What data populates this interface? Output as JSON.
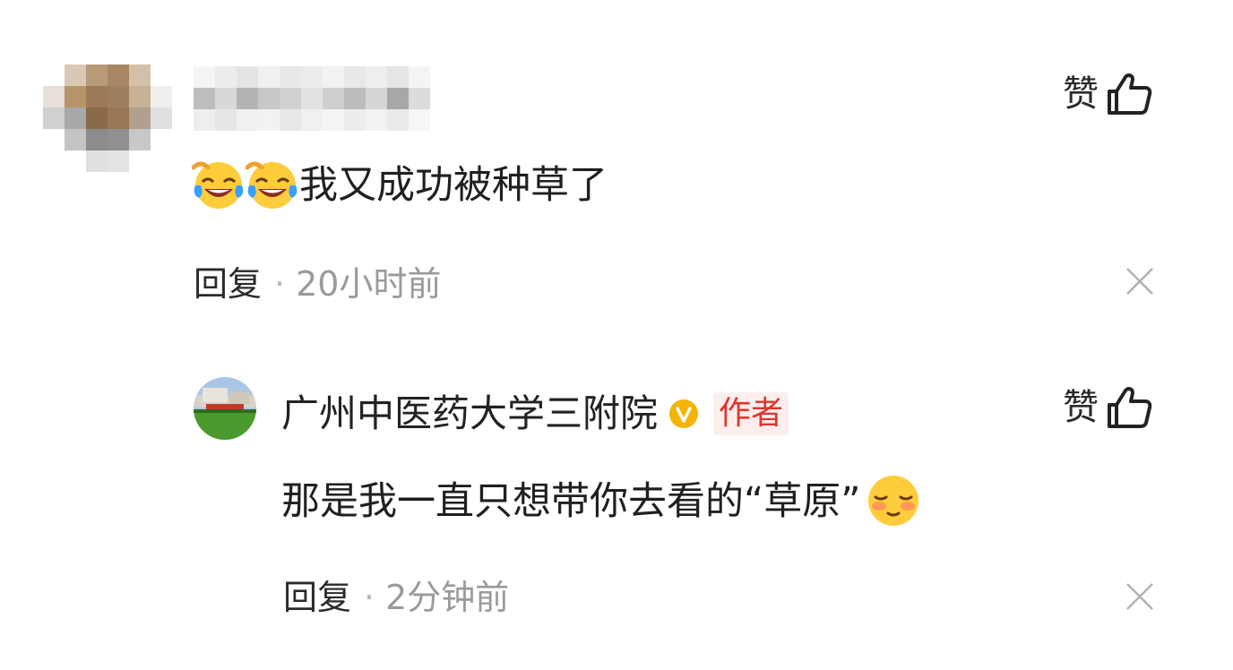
{
  "comments": [
    {
      "user_name": "",
      "text": "我又成功被种草了",
      "emojis": [
        "crying-laughing-emoji",
        "crying-laughing-emoji"
      ],
      "reply_label": "回复",
      "separator": "·",
      "time": "20小时前",
      "like_label": "赞"
    },
    {
      "user_name": "广州中医药大学三附院",
      "verified": true,
      "author_tag": "作者",
      "text": "那是我一直只想带你去看的“草原”",
      "emojis": [
        "blushing-smile-emoji"
      ],
      "reply_label": "回复",
      "separator": "·",
      "time": "2分钟前",
      "like_label": "赞"
    }
  ],
  "colors": {
    "author_tag_text": "#e0352b",
    "author_tag_bg": "#fdeeee",
    "verified_badge": "#f5b400",
    "time_text": "#9a9a9a"
  }
}
